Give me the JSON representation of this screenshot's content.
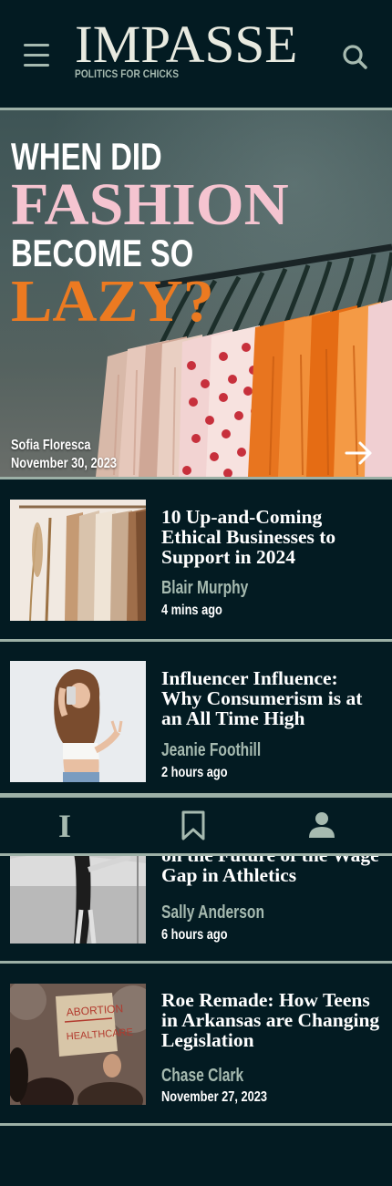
{
  "header": {
    "title": "IMPASSE",
    "tagline": "POLITICS FOR CHICKS",
    "menu_icon": "hamburger-menu-icon",
    "search_icon": "search-icon"
  },
  "hero": {
    "headline_line1": "WHEN DID",
    "headline_line2": "FASHION",
    "headline_line3": "BECOME SO",
    "headline_line4": "LAZY?",
    "author": "Sofia Floresca",
    "date": "November 30, 2023",
    "arrow_icon": "arrow-right-icon",
    "colors": {
      "pink": "#f5c4d0",
      "orange": "#ec7a21"
    }
  },
  "articles": [
    {
      "title": "10 Up-and-Coming Ethical Businesses to Support in 2024",
      "author": "Blair Murphy",
      "time": "4 mins ago"
    },
    {
      "title": "Influencer Influence: Why Consumerism is at an All Time High",
      "author": "Jeanie Foothill",
      "time": "2 hours ago"
    },
    {
      "title": "on the Future of the Wage Gap in Athletics",
      "author": "Sally Anderson",
      "time": "6 hours ago"
    },
    {
      "title": "Roe Remade: How Teens in Arkansas are Changing Legislation",
      "author": "Chase Clark",
      "time": "November 27, 2023"
    }
  ],
  "tabbar": {
    "home_label": "I",
    "bookmark_icon": "bookmark-icon",
    "profile_icon": "profile-icon"
  },
  "colors": {
    "background": "#031b22",
    "muted": "#a6bab0",
    "divider": "#9cb0a6",
    "text": "#ffffff"
  },
  "thumbnail_text": {
    "protest_sign_line1": "ABORTION",
    "protest_sign_line2": "HEALTHCARE"
  }
}
